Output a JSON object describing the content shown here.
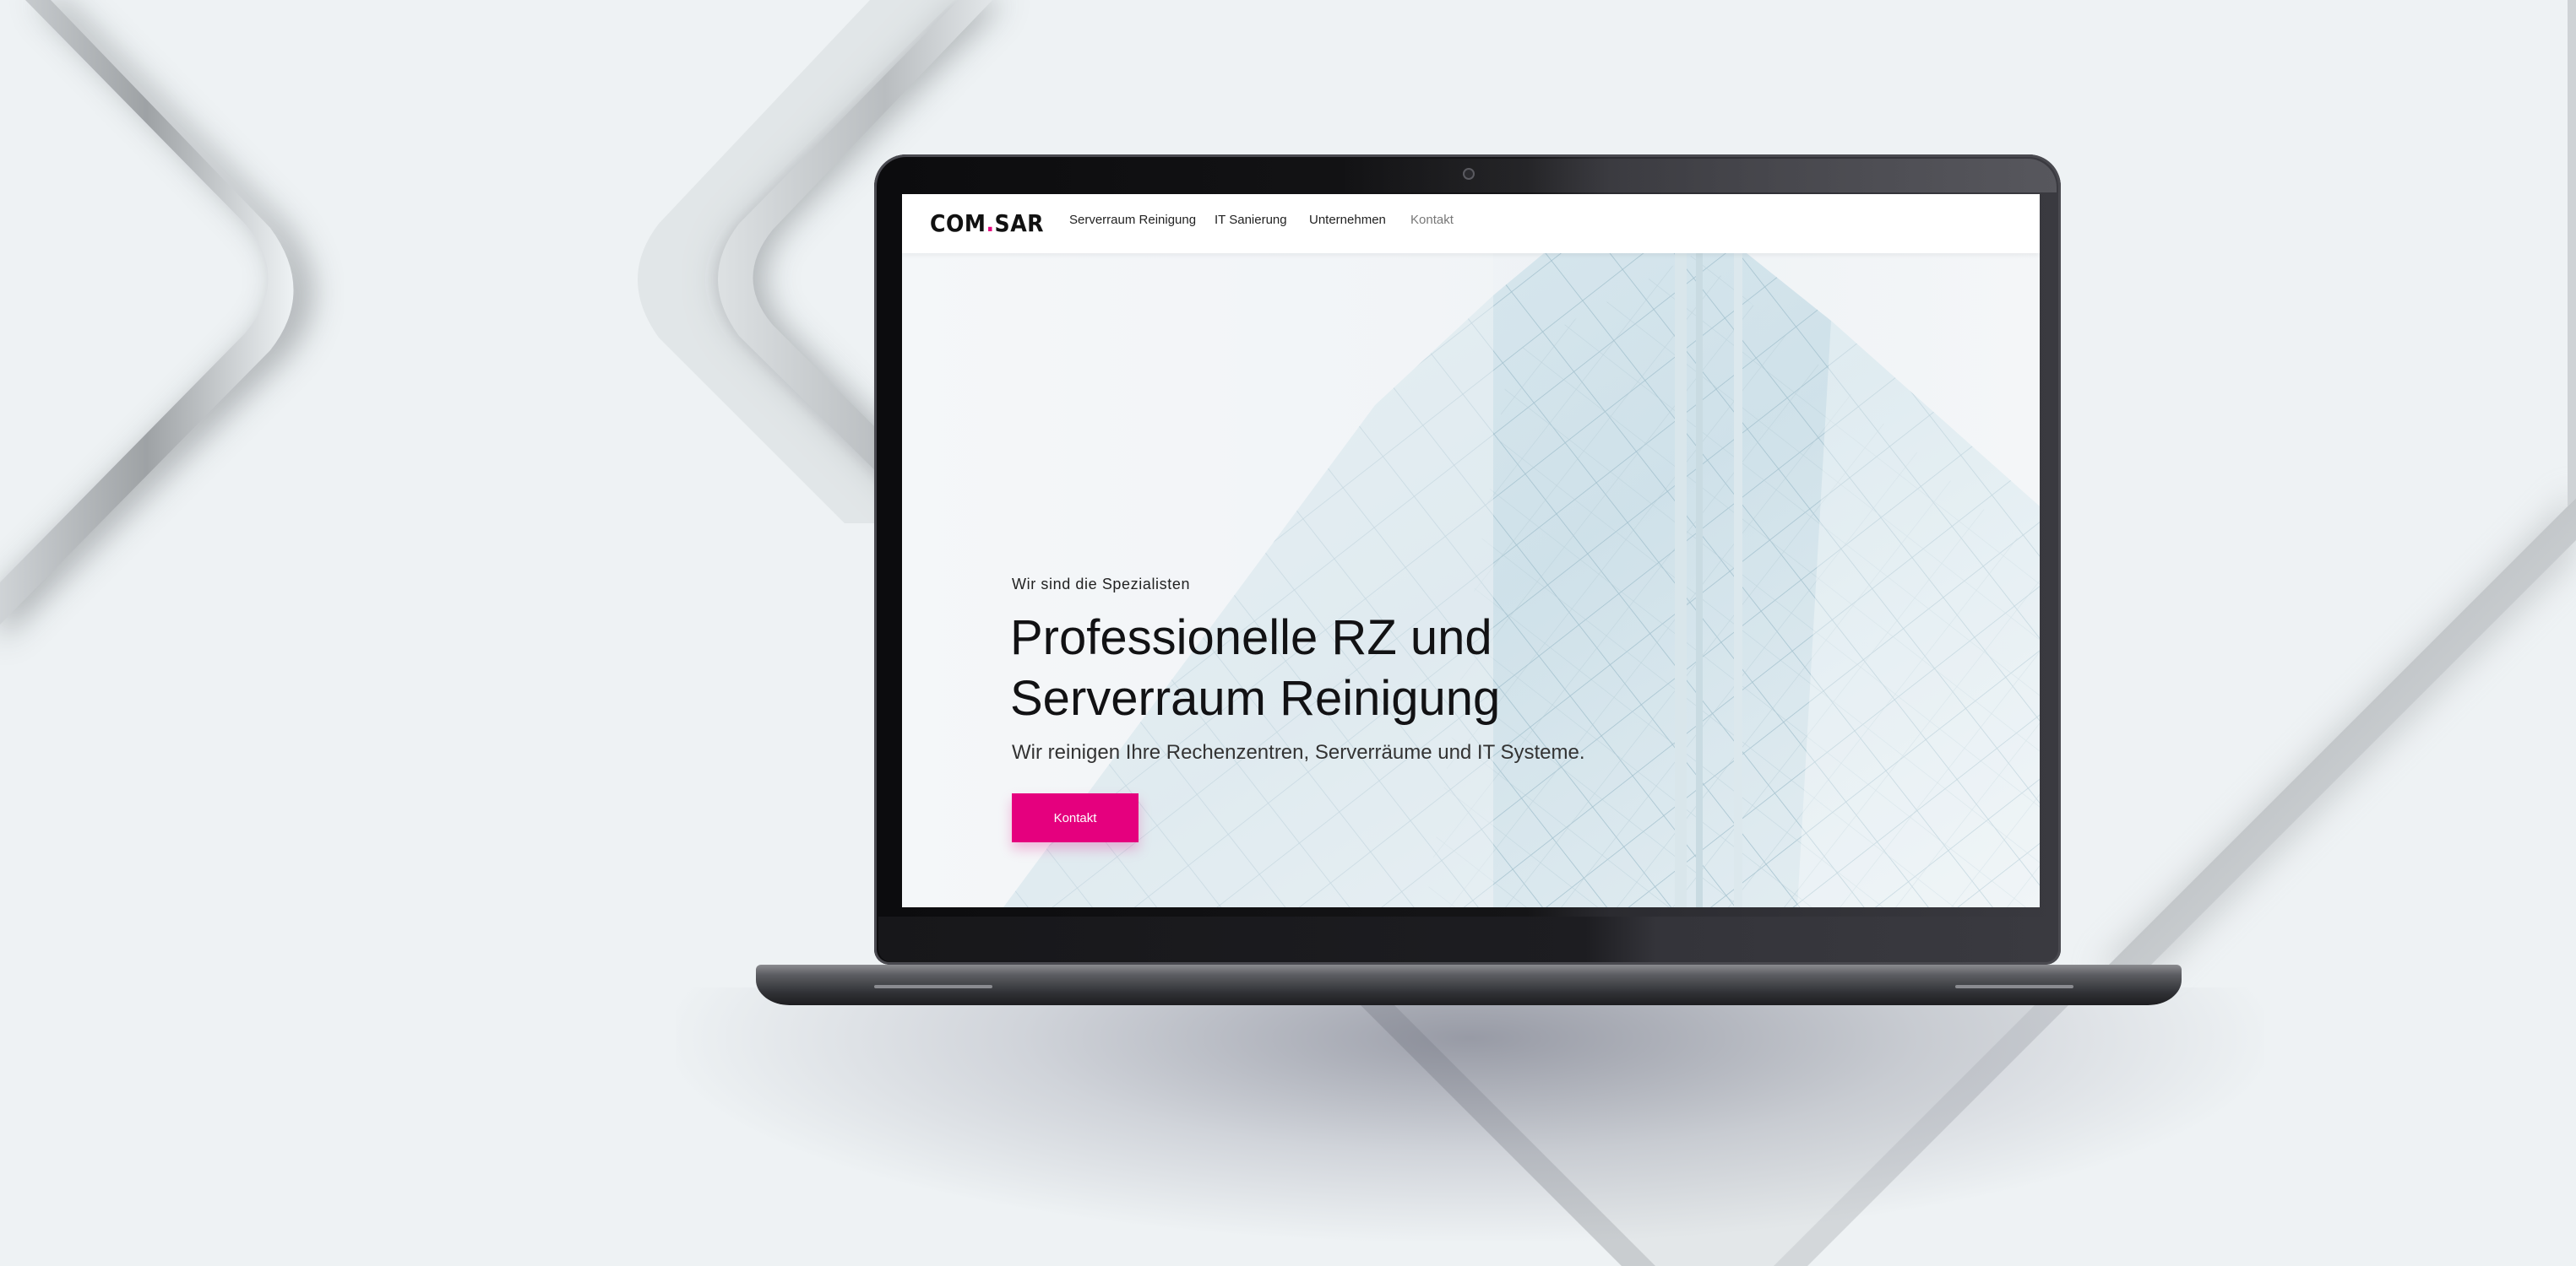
{
  "brand": {
    "logo_left": "COM",
    "logo_dot": ".",
    "logo_right": "SAR",
    "accent_color": "#e5007e"
  },
  "nav": {
    "items": [
      {
        "label": "Serverraum Reinigung"
      },
      {
        "label": "IT Sanierung"
      },
      {
        "label": "Unternehmen"
      },
      {
        "label": "Kontakt"
      }
    ]
  },
  "hero": {
    "eyebrow": "Wir sind die Spezialisten",
    "headline_line1": "Professionelle RZ und",
    "headline_line2": "Serverraum Reinigung",
    "subline": "Wir reinigen Ihre Rechenzentren, Serverräume und IT Systeme.",
    "cta_label": "Kontakt"
  },
  "icons": [
    "camera-icon"
  ]
}
